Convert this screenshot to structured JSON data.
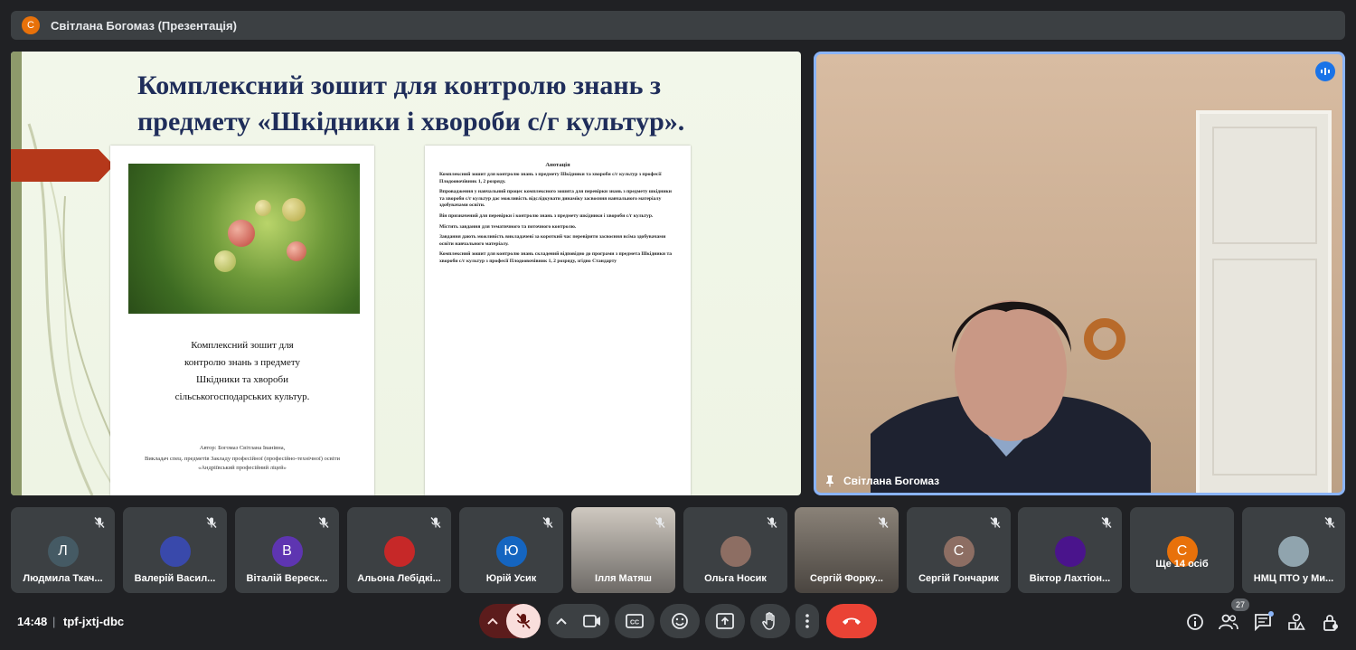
{
  "presenter_bar": {
    "initial": "С",
    "title": "Світлана Богомаз (Презентація)"
  },
  "slide": {
    "heading_line1": "Комплексний зошит для контролю знань з",
    "heading_line2": "предмету «Шкідники і хвороби с/г культур».",
    "page1": {
      "title_lines": [
        "Комплексний зошит для",
        "контролю знань з предмету",
        "Шкідники та хвороби",
        "сільськогосподарських  культур."
      ],
      "author_lines": [
        "Автор: Богомаз Світлана Іванівна,",
        "Викладач спец. предметів Закладу професійної (професійно-технічної) освіти",
        "«Андріївський професійний ліцей»"
      ]
    },
    "page2": {
      "title": "Анотація",
      "paragraphs": [
        "Комплексний зошит для контролю знань з предмету Шкідники та хвороби с/г культур з професії Плодоовочівник 1, 2 розряду.",
        "Впровадження у навчальний процес комплексного зошита для перевірки знань з предмету шкідники та хвороби с/г культур дає можливість відслідкувати динаміку засвоєння навчального матеріалу здобувачами освіти.",
        " Він призначений для перевірки і контролю знань з предмету шкідники і хвороби с/г культур.",
        "  Містить завдання для тематичного та поточного контролю.",
        "  Завдання дають можливість викладачеві за короткий час перевірити засвоєння всіма здобувачами освіти навчального матеріалу.",
        "  Комплексний зошит для контролю знань складений відповідно до програми з предмета Шкідники та хвороби с/г культур з професії Плодоовочівник 1, 2 розряду, згідно Стандарту"
      ]
    }
  },
  "speaker": {
    "name": "Світлана Богомаз"
  },
  "participants": [
    {
      "initial": "Л",
      "name": "Людмила Ткач...",
      "color": "#455a64"
    },
    {
      "initial": "",
      "name": "Валерій Васил...",
      "color": "#3949ab"
    },
    {
      "initial": "В",
      "name": "Віталій Вереск...",
      "color": "#5e35b1"
    },
    {
      "initial": "",
      "name": "Альона Лебідкі...",
      "color": "#c62828"
    },
    {
      "initial": "Ю",
      "name": "Юрій Усик",
      "color": "#1565c0"
    },
    {
      "initial": "",
      "name": "Ілля Матяш",
      "color": "#666"
    },
    {
      "initial": "",
      "name": "Ольга Носик",
      "color": "#8d6e63"
    },
    {
      "initial": "",
      "name": "Сергій Форку...",
      "color": "#666"
    },
    {
      "initial": "С",
      "name": "Сергій Гончарик",
      "color": "#8d6e63"
    },
    {
      "initial": "",
      "name": "Віктор Лахтіон...",
      "color": "#4a148c"
    },
    {
      "initial": "С",
      "name": "Ще 14 осіб",
      "color": "#e8710a"
    },
    {
      "initial": "",
      "name": "НМЦ ПТО у Ми...",
      "color": "#90a4ae"
    }
  ],
  "bottom": {
    "time": "14:48",
    "separator": "|",
    "meeting_code": "tpf-jxtj-dbc",
    "participant_count": "27"
  },
  "colors": {
    "accent": "#8ab4f8",
    "end_call": "#ea4335",
    "mic_off": "#f9dedc"
  }
}
